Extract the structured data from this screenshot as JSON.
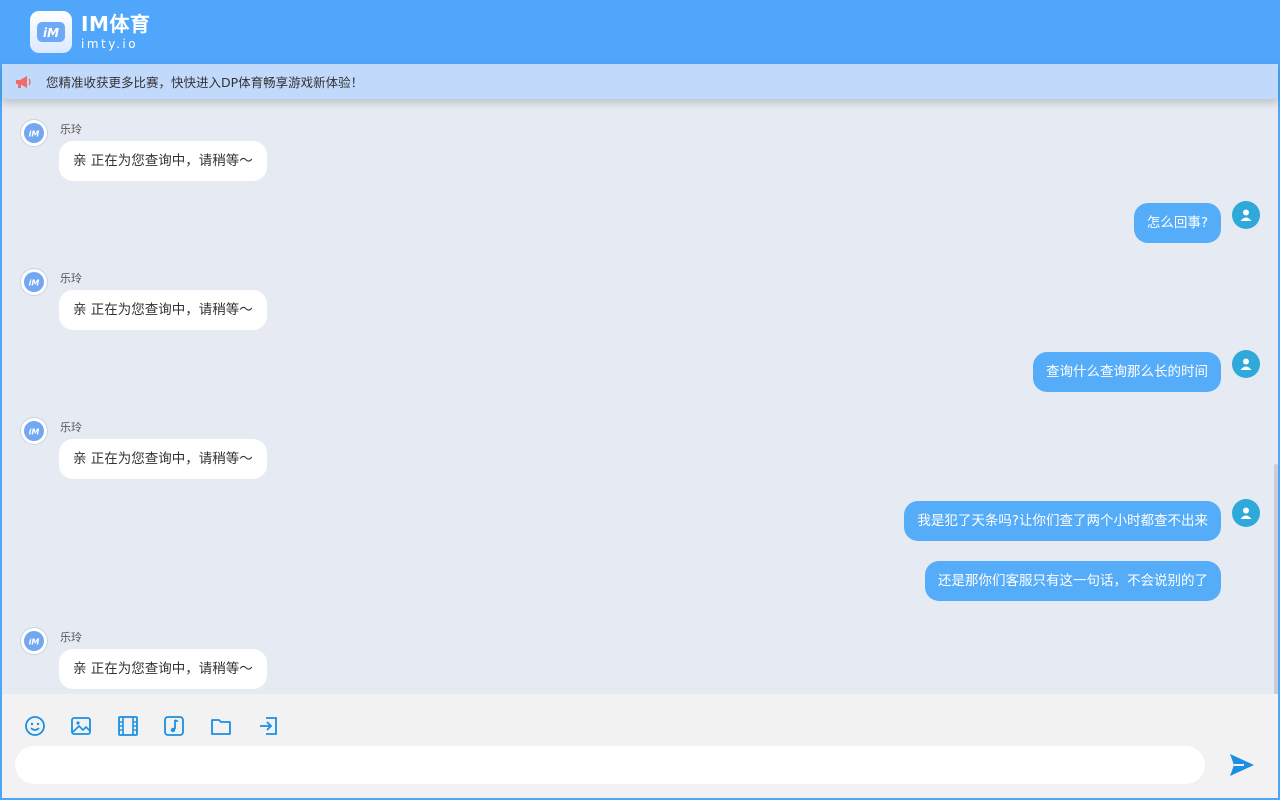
{
  "header": {
    "brand_name": "IM体育",
    "brand_domain": "imty.io",
    "logo_text": "iM"
  },
  "notice": {
    "text": "您精准收获更多比赛，快快进入DP体育畅享游戏新体验！"
  },
  "messages": [
    {
      "side": "left",
      "sender": "乐玲",
      "text": "亲 正在为您查询中，请稍等～"
    },
    {
      "side": "right",
      "text": "怎么回事?"
    },
    {
      "side": "left",
      "sender": "乐玲",
      "text": "亲 正在为您查询中，请稍等～"
    },
    {
      "side": "right",
      "text": "查询什么查询那么长的时间"
    },
    {
      "side": "left",
      "sender": "乐玲",
      "text": "亲 正在为您查询中，请稍等～"
    },
    {
      "side": "right",
      "text": "我是犯了天条吗?让你们查了两个小时都查不出来"
    },
    {
      "side": "right",
      "text": "还是那你们客服只有这一句话，不会说别的了"
    },
    {
      "side": "left",
      "sender": "乐玲",
      "text": "亲 正在为您查询中，请稍等～"
    }
  ],
  "toolbar": {
    "tools": [
      "emoji-icon",
      "image-icon",
      "video-icon",
      "music-icon",
      "folder-icon",
      "exit-icon"
    ]
  },
  "input": {
    "value": "",
    "placeholder": ""
  },
  "colors": {
    "header_bg": "#4fa6fb",
    "notice_bg": "#c1d9fb",
    "chat_bg": "#e6ebf3",
    "bubble_right": "#55acf8",
    "bubble_left": "#ffffff",
    "icon_blue": "#1a8fe3"
  }
}
